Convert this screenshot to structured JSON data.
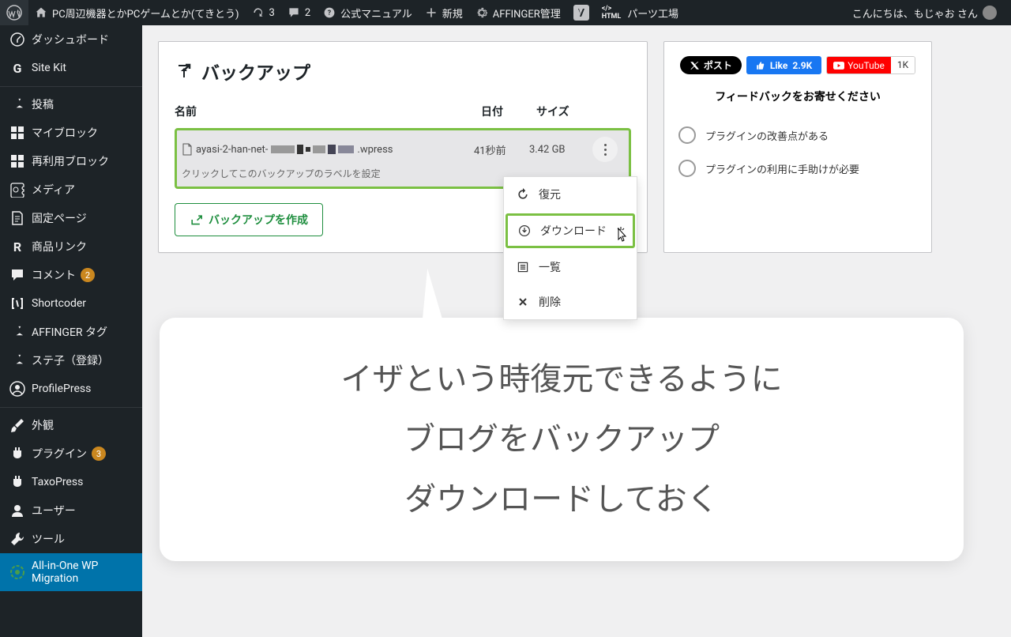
{
  "adminbar": {
    "site_title": "PC周辺機器とかPCゲームとか(てきとう)",
    "refresh_count": "3",
    "comment_count": "2",
    "manual": "公式マニュアル",
    "new": "新規",
    "affinger": "AFFINGER管理",
    "parts": "パーツ工場",
    "greeting": "こんにちは、もじゃお さん"
  },
  "sidebar": [
    {
      "icon": "dashboard",
      "label": "ダッシュボード"
    },
    {
      "icon": "sitekit",
      "label": "Site Kit"
    },
    {
      "sep": true
    },
    {
      "icon": "pin",
      "label": "投稿"
    },
    {
      "icon": "grid",
      "label": "マイブロック"
    },
    {
      "icon": "grid",
      "label": "再利用ブロック"
    },
    {
      "icon": "media",
      "label": "メディア"
    },
    {
      "icon": "page",
      "label": "固定ページ"
    },
    {
      "icon": "R",
      "label": "商品リンク"
    },
    {
      "icon": "comment",
      "label": "コメント",
      "badge": "2",
      "badge_color": "orange"
    },
    {
      "icon": "shortcoder",
      "label": "Shortcoder"
    },
    {
      "icon": "pin",
      "label": "AFFINGER タグ"
    },
    {
      "icon": "pin",
      "label": "ステ子（登録）"
    },
    {
      "icon": "profile",
      "label": "ProfilePress"
    },
    {
      "sep": true
    },
    {
      "icon": "brush",
      "label": "外観"
    },
    {
      "icon": "plugin",
      "label": "プラグイン",
      "badge": "3",
      "badge_color": "orange"
    },
    {
      "icon": "plugin",
      "label": "TaxoPress"
    },
    {
      "icon": "users",
      "label": "ユーザー"
    },
    {
      "icon": "tools",
      "label": "ツール"
    },
    {
      "icon": "migrate",
      "label": "All-in-One WP Migration",
      "current": true
    }
  ],
  "backup": {
    "title": "バックアップ",
    "columns": {
      "name": "名前",
      "date": "日付",
      "size": "サイズ"
    },
    "item": {
      "filename_prefix": "ayasi-2-han-net-",
      "filename_suffix": ".wpress",
      "date": "41秒前",
      "size": "3.42 GB",
      "subtext": "クリックしてこのバックアップのラベルを設定"
    },
    "create_button": "バックアップを作成",
    "menu": {
      "restore": "復元",
      "download": "ダウンロード",
      "list": "一覧",
      "delete": "削除"
    }
  },
  "feedback": {
    "post_btn": "ポスト",
    "like_text": "Like",
    "like_count": "2.9K",
    "youtube": "YouTube",
    "youtube_count": "1K",
    "title": "フィードバックをお寄せください",
    "option1": "プラグインの改善点がある",
    "option2": "プラグインの利用に手助けが必要"
  },
  "callout": {
    "line1": "イザという時復元できるように",
    "line2": "ブログをバックアップ",
    "line3": "ダウンロードしておく"
  }
}
